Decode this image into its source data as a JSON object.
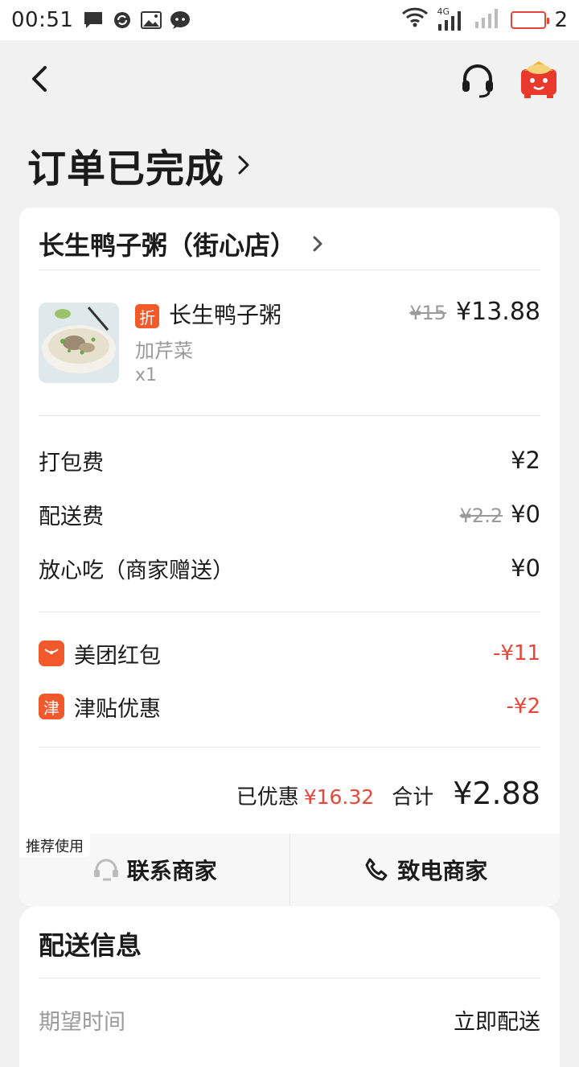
{
  "status_bar": {
    "time": "00:51",
    "network_label": "4G",
    "battery_number": "2",
    "icons": [
      "message-icon",
      "sync-icon",
      "image-icon",
      "wechat-icon",
      "wifi-icon",
      "signal-4g-icon",
      "signal-icon",
      "battery-icon"
    ]
  },
  "header": {
    "back_icon": "chevron-left-icon",
    "customer_service_icon": "headset-icon",
    "gift_icon": "red-packet-gift-icon"
  },
  "order_status": {
    "title": "订单已完成"
  },
  "store": {
    "name": "长生鸭子粥（街心店）"
  },
  "items": [
    {
      "tag": "折",
      "name": "长生鸭子粥",
      "spec": "加芹菜",
      "qty": "x1",
      "original_price": "¥15",
      "price": "¥13.88"
    }
  ],
  "fees": [
    {
      "label": "打包费",
      "value": "¥2"
    },
    {
      "label": "配送费",
      "original": "¥2.2",
      "value": "¥0"
    },
    {
      "label": "放心吃（商家赠送）",
      "value": "¥0"
    }
  ],
  "discounts": [
    {
      "label": "美团红包",
      "value": "-¥11",
      "icon": "red-packet-icon"
    },
    {
      "label": "津贴优惠",
      "value": "-¥2",
      "icon_text": "津"
    }
  ],
  "summary": {
    "saved_label": "已优惠",
    "saved_amount": "¥16.32",
    "total_label": "合计",
    "total_amount": "¥2.88"
  },
  "actions": {
    "recommend_tag": "推荐使用",
    "contact_label": "联系商家",
    "call_label": "致电商家"
  },
  "delivery": {
    "title": "配送信息",
    "rows": [
      {
        "label": "期望时间",
        "value": "立即配送"
      }
    ]
  },
  "colors": {
    "accent": "#f25a2b",
    "discount_red": "#e9463b",
    "background": "#f1f1f1"
  }
}
